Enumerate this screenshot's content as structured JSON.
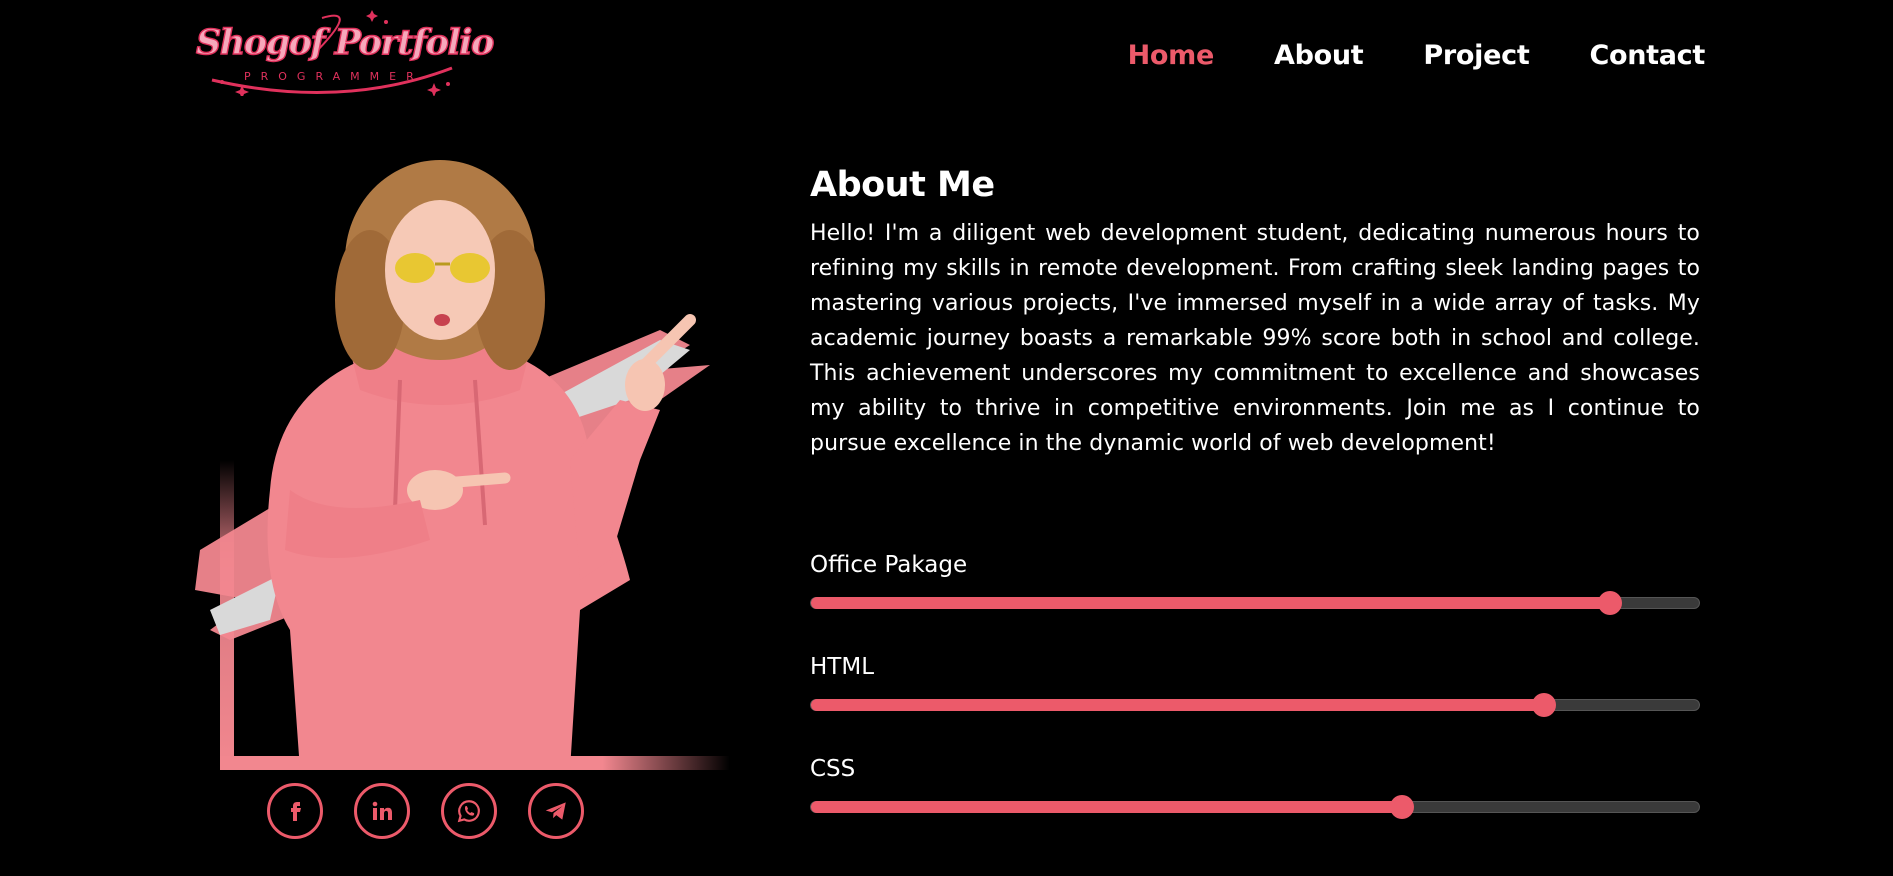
{
  "brand": {
    "title": "Shogof Portfolio",
    "subtitle": "PROGRAMMER"
  },
  "nav": {
    "items": [
      {
        "label": "Home",
        "active": true
      },
      {
        "label": "About",
        "active": false
      },
      {
        "label": "Project",
        "active": false
      },
      {
        "label": "Contact",
        "active": false
      }
    ]
  },
  "about": {
    "title": "About Me",
    "text": "Hello! I'm a diligent web development student, dedicating numerous hours to refining my skills in remote development. From crafting sleek landing pages to mastering various projects, I've immersed myself in a wide array of tasks. My academic journey boasts a remarkable 99% score both in school and college. This achievement underscores my commitment to excellence and showcases my ability to thrive in competitive environments. Join me as I continue to pursue excellence in the dynamic world of web development!"
  },
  "skills": [
    {
      "label": "Office Pakage",
      "value": 90
    },
    {
      "label": "HTML",
      "value": 82.5
    },
    {
      "label": "CSS",
      "value": 66.5
    }
  ],
  "social": [
    {
      "icon": "facebook-icon"
    },
    {
      "icon": "linkedin-icon"
    },
    {
      "icon": "whatsapp-icon"
    },
    {
      "icon": "telegram-icon"
    }
  ],
  "colors": {
    "accent": "#ec5a6a",
    "background": "#000000",
    "text": "#ffffff",
    "track": "#3a3a3a",
    "hoodie": "#f2878f"
  }
}
